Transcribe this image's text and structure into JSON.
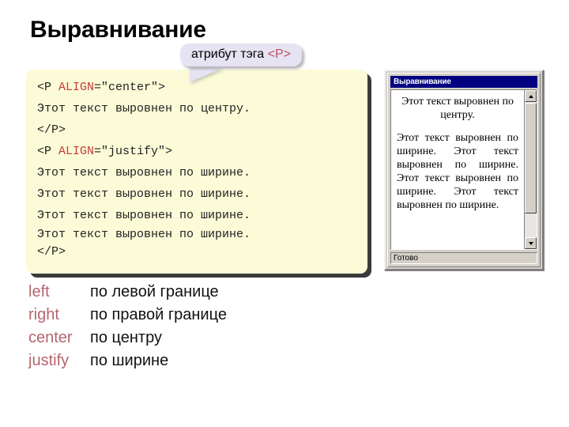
{
  "slide": {
    "title": "Выравнивание"
  },
  "callout": {
    "text_prefix": "атрибут тэга ",
    "tag": "<P>",
    "tag_color": "#c0505f",
    "bubble_color": "#e6e3f2"
  },
  "code": {
    "background": "#fbfbd8",
    "keyword_color": "#c83a3a",
    "lines": [
      {
        "pre": "<P ",
        "kw": "ALIGN",
        "post": "=\"center\">"
      },
      {
        "pre": "Этот текст выровнен по центру.",
        "kw": "",
        "post": ""
      },
      {
        "pre": "</P>",
        "kw": "",
        "post": ""
      },
      {
        "pre": "<P ",
        "kw": "ALIGN",
        "post": "=\"justify\">"
      },
      {
        "pre": "Этот текст выровнен по ширине.",
        "kw": "",
        "post": ""
      },
      {
        "pre": "Этот текст выровнен по ширине.",
        "kw": "",
        "post": ""
      },
      {
        "pre": "Этот текст выровнен по ширине.",
        "kw": "",
        "post": ""
      },
      {
        "pre": "Этот текст выровнен по ширине.",
        "kw": "",
        "post": ""
      },
      {
        "pre": "</P>",
        "kw": "",
        "post": ""
      }
    ]
  },
  "legend": {
    "key_color": "#b5656e",
    "rows": [
      {
        "key": "left",
        "value": "по левой границе"
      },
      {
        "key": "right",
        "value": "по правой границе"
      },
      {
        "key": "center",
        "value": "по центру"
      },
      {
        "key": "justify",
        "value": "по ширине"
      }
    ]
  },
  "browser": {
    "title": "Выравнивание",
    "titlebar_color": "#000080",
    "status": "Готово",
    "page": {
      "centered_paragraph": "Этот текст выровнен по центру.",
      "justified_paragraph": "Этот текст выровнен по ширине. Этот текст выровнен по ширине. Этот текст выровнен по ширине. Этот текст выровнен по ширине."
    },
    "scrollbar": {
      "up_arrow": "scroll-up-icon",
      "down_arrow": "scroll-down-icon"
    }
  }
}
